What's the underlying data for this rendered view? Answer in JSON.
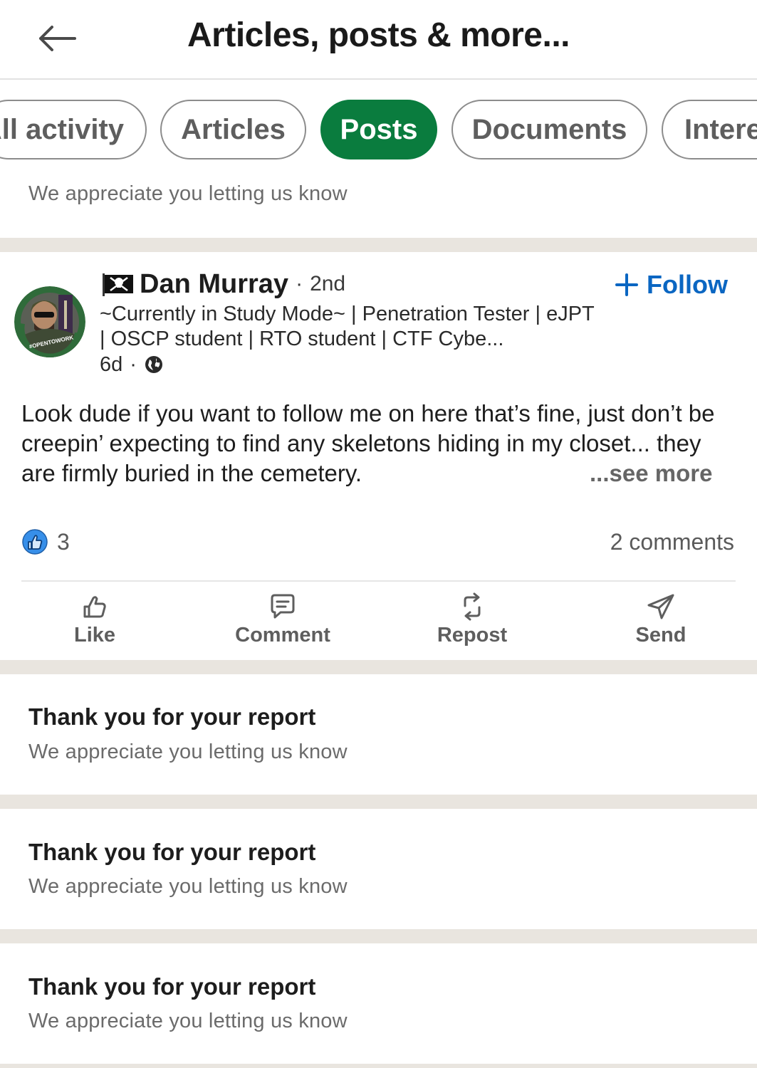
{
  "header": {
    "title": "Articles, posts & more..."
  },
  "filters": [
    {
      "label": "All activity",
      "active": false
    },
    {
      "label": "Articles",
      "active": false
    },
    {
      "label": "Posts",
      "active": true
    },
    {
      "label": "Documents",
      "active": false
    },
    {
      "label": "Interests",
      "active": false
    }
  ],
  "top_notice": {
    "subtitle": "We appreciate you letting us know"
  },
  "post": {
    "author": {
      "flag_icon": "pirate-flag-icon",
      "name": "Dan Murray",
      "separator": "·",
      "degree": "2nd",
      "headline": "~Currently in Study Mode~ | Penetration Tester | eJPT | OSCP student | RTO student | CTF Cybe...",
      "time": "6d",
      "time_separator": "·",
      "visibility_icon": "globe-icon",
      "avatar_badge": "#OPENTOWORK"
    },
    "follow_label": "Follow",
    "body": "Look dude if you want to follow me on here that’s fine, just don’t be creepin’ expecting to find any skeletons hiding in my closet... they are firmly buried in the cemetery.",
    "see_more": "...see more",
    "reaction_count": "3",
    "comments": "2 comments",
    "actions": [
      {
        "label": "Like",
        "icon": "thumbs-up-icon"
      },
      {
        "label": "Comment",
        "icon": "comment-icon"
      },
      {
        "label": "Repost",
        "icon": "repost-icon"
      },
      {
        "label": "Send",
        "icon": "send-icon"
      }
    ]
  },
  "reports": [
    {
      "title": "Thank you for your report",
      "subtitle": "We appreciate you letting us know"
    },
    {
      "title": "Thank you for your report",
      "subtitle": "We appreciate you letting us know"
    },
    {
      "title": "Thank you for your report",
      "subtitle": "We appreciate you letting us know"
    }
  ],
  "colors": {
    "accent_green": "#0a7c3e",
    "link_blue": "#0a66c2",
    "divider": "#e9e5df"
  }
}
